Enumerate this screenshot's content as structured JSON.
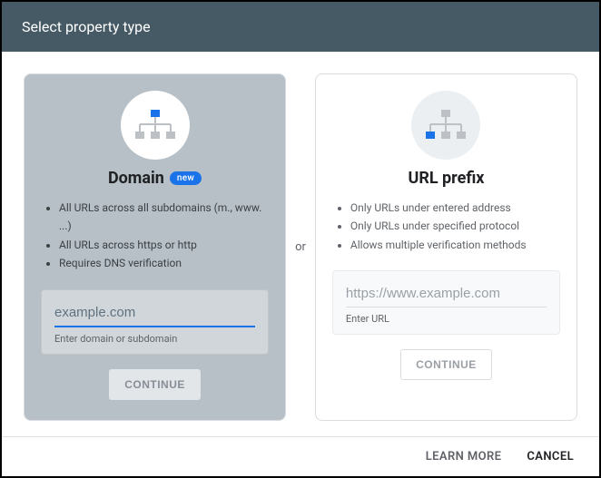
{
  "header": {
    "title": "Select property type"
  },
  "divider_label": "or",
  "domain_card": {
    "title": "Domain",
    "badge": "new",
    "features": [
      "All URLs across all subdomains (m., www. ...)",
      "All URLs across https or http",
      "Requires DNS verification"
    ],
    "input_placeholder": "example.com",
    "input_hint": "Enter domain or subdomain",
    "continue_label": "CONTINUE"
  },
  "prefix_card": {
    "title": "URL prefix",
    "features": [
      "Only URLs under entered address",
      "Only URLs under specified protocol",
      "Allows multiple verification methods"
    ],
    "input_placeholder": "https://www.example.com",
    "input_hint": "Enter URL",
    "continue_label": "CONTINUE"
  },
  "footer": {
    "learn_more": "LEARN MORE",
    "cancel": "CANCEL"
  }
}
